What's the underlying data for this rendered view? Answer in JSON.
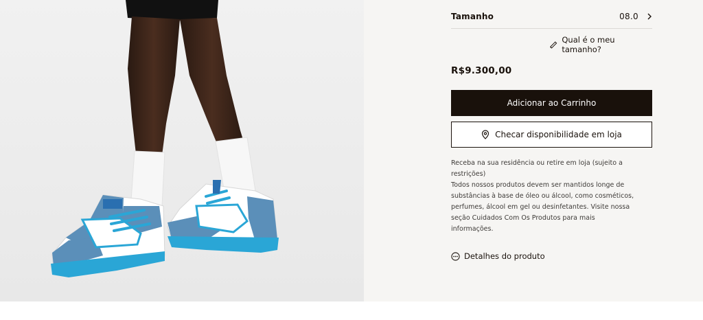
{
  "product": {
    "size_label": "Tamanho",
    "size_value": "08.0",
    "size_guide_label": "Qual é o meu tamanho?",
    "price": "R$9.300,00",
    "add_to_cart_label": "Adicionar ao Carrinho",
    "check_store_label": "Checar disponibilidade em loja",
    "delivery_info": "Receba na sua residência ou retire em loja (sujeito a restrições)",
    "care_info": "Todos nossos produtos devem ser mantidos longe de substâncias à base de óleo ou álcool, como cosméticos, perfumes, álcool em gel ou desinfetantes. Visite nossa seção Cuidados Com Os Produtos para mais informações.",
    "details_label": "Detalhes do produto"
  },
  "icons": {
    "chevron": "chevron-right-icon",
    "ruler": "ruler-icon",
    "location": "location-pin-icon",
    "details": "more-circle-icon"
  },
  "colors": {
    "primary": "#19110b",
    "panel_bg": "#f6f5f3",
    "sneaker_blue": "#2aa6d6",
    "sneaker_denim": "#5b8fb9"
  }
}
